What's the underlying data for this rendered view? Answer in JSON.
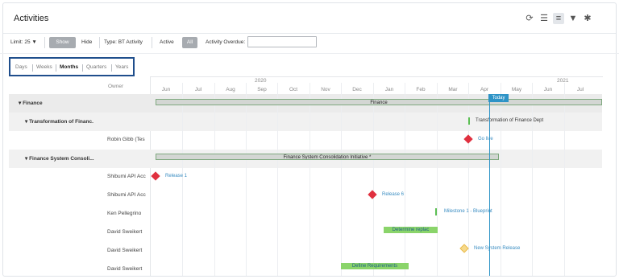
{
  "header": {
    "title": "Activities"
  },
  "toolbar_icons": [
    "refresh-icon",
    "list-icon",
    "gantt-icon",
    "filter-icon",
    "gear-icon"
  ],
  "filters": {
    "limit_label": "Limit: 25 ▼",
    "show_label": "Show",
    "hide_label": "Hide",
    "type_label": "Type: BT Activity",
    "active_label": "Active",
    "all_label": "All",
    "overdue_label": "Activity Overdue:",
    "overdue_value": ""
  },
  "timescale": {
    "days": "Days",
    "weeks": "Weeks",
    "months": "Months",
    "quarters": "Quarters",
    "years": "Years",
    "selected": "Months"
  },
  "gantt": {
    "owner_header": "Owner",
    "years": [
      "2020",
      "2021"
    ],
    "months": [
      "Jun",
      "Jul",
      "Aug",
      "Sep",
      "Oct",
      "Nov",
      "Dec",
      "Jan",
      "Feb",
      "Mar",
      "Apr",
      "May",
      "Jun",
      "Jul"
    ],
    "today_label": "Today",
    "rows": [
      {
        "label": "▾ Finance"
      },
      {
        "label": "▾ Transformation of Financ."
      },
      {
        "label": "Robin Gibb (Tes"
      },
      {
        "label": "▾ Finance System Consoli..."
      },
      {
        "label": "Shibumi API Acc"
      },
      {
        "label": "Shibumi API Acc"
      },
      {
        "label": "Ken Pellegrino"
      },
      {
        "label": "David Sweikert"
      },
      {
        "label": "David Sweikert"
      },
      {
        "label": "David Sweikert"
      }
    ],
    "bars": {
      "finance": "Finance",
      "transformation": "Transformation of Finance Dept",
      "go_live": "Go live",
      "consolidation": "Finance System Consolidation Initiative *",
      "release1": "Release 1",
      "release6": "Release 6",
      "milestone1": "Milestone 1 - Blueprint",
      "determine": "Determine replac",
      "new_system": "New System Release",
      "define": "Define Requirements"
    }
  },
  "colors": {
    "today": "#2d93c6",
    "milestone_red": "#e0303f",
    "bar_green": "#8ad46a",
    "highlight_box": "#1f4e8c"
  }
}
